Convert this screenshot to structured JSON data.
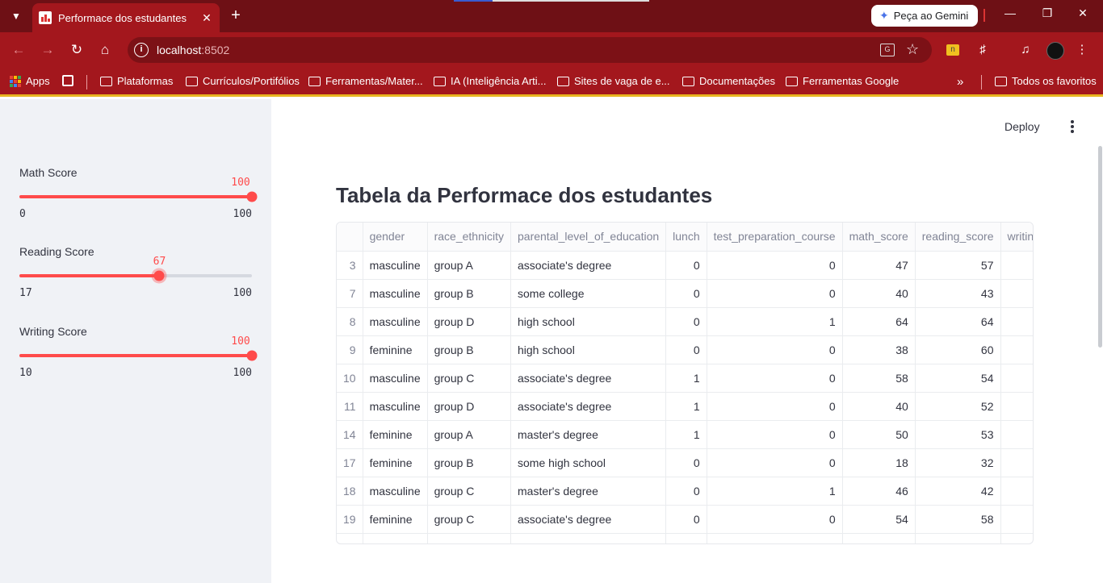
{
  "browser": {
    "tab_title": "Performace dos estudantes",
    "url_host": "localhost",
    "url_port": ":8502",
    "gemini_label": "Peça ao Gemini",
    "bookmarks": [
      {
        "label": "Apps",
        "kind": "apps"
      },
      {
        "label": "Plataformas",
        "kind": "folder"
      },
      {
        "label": "Currículos/Portifólios",
        "kind": "folder"
      },
      {
        "label": "Ferramentas/Mater...",
        "kind": "folder"
      },
      {
        "label": "IA (Inteligência Arti...",
        "kind": "folder"
      },
      {
        "label": "Sites de vaga de e...",
        "kind": "folder"
      },
      {
        "label": "Documentações",
        "kind": "folder"
      },
      {
        "label": "Ferramentas Google",
        "kind": "folder"
      }
    ],
    "all_bookmarks_label": "Todos os favoritos",
    "accent_color": "#a3171d"
  },
  "sidebar": {
    "sliders": [
      {
        "label": "Math Score",
        "value": 100,
        "min": 0,
        "max": 100,
        "min_label": "0",
        "max_label": "100",
        "value_label": "100"
      },
      {
        "label": "Reading Score",
        "value": 67,
        "min": 17,
        "max": 100,
        "min_label": "17",
        "max_label": "100",
        "value_label": "67"
      },
      {
        "label": "Writing Score",
        "value": 100,
        "min": 10,
        "max": 100,
        "min_label": "10",
        "max_label": "100",
        "value_label": "100"
      }
    ],
    "slider_color": "#ff4b4b"
  },
  "main": {
    "deploy_label": "Deploy",
    "title": "Tabela da Performace dos estudantes",
    "table": {
      "columns": [
        "",
        "gender",
        "race_ethnicity",
        "parental_level_of_education",
        "lunch",
        "test_preparation_course",
        "math_score",
        "reading_score",
        "writing_"
      ],
      "rows": [
        [
          "3",
          "masculine",
          "group A",
          "associate's degree",
          "0",
          "0",
          "47",
          "57",
          ""
        ],
        [
          "7",
          "masculine",
          "group B",
          "some college",
          "0",
          "0",
          "40",
          "43",
          ""
        ],
        [
          "8",
          "masculine",
          "group D",
          "high school",
          "0",
          "1",
          "64",
          "64",
          ""
        ],
        [
          "9",
          "feminine",
          "group B",
          "high school",
          "0",
          "0",
          "38",
          "60",
          ""
        ],
        [
          "10",
          "masculine",
          "group C",
          "associate's degree",
          "1",
          "0",
          "58",
          "54",
          ""
        ],
        [
          "11",
          "masculine",
          "group D",
          "associate's degree",
          "1",
          "0",
          "40",
          "52",
          ""
        ],
        [
          "14",
          "feminine",
          "group A",
          "master's degree",
          "1",
          "0",
          "50",
          "53",
          ""
        ],
        [
          "17",
          "feminine",
          "group B",
          "some high school",
          "0",
          "0",
          "18",
          "32",
          ""
        ],
        [
          "18",
          "masculine",
          "group C",
          "master's degree",
          "0",
          "1",
          "46",
          "42",
          ""
        ],
        [
          "19",
          "feminine",
          "group C",
          "associate's degree",
          "0",
          "0",
          "54",
          "58",
          ""
        ],
        [
          "",
          "",
          "",
          "",
          "",
          "",
          "",
          "",
          ""
        ]
      ]
    }
  }
}
